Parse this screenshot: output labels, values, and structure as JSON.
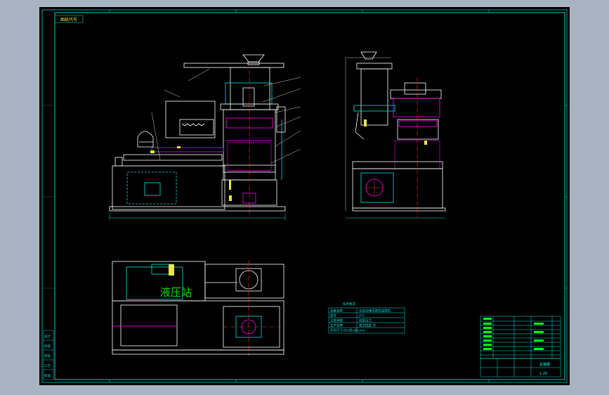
{
  "drawing": {
    "code_label": "图纸代号",
    "hydraulic_station_label": "液压站",
    "colors": {
      "sheet": "#000000",
      "frame": "#00c8c8",
      "geometry": "#ffffff",
      "hidden": "#ff00ff",
      "centerline": "#ff3030",
      "dims": "#00e0e0",
      "text_yellow": "#e8e840",
      "text_green": "#00e000"
    },
    "tech_table": {
      "title": "技术要求",
      "rows": [
        {
          "label": "设备名称",
          "value": "全自动液压砖机成型机"
        },
        {
          "label": "型号",
          "value": "JY-5"
        },
        {
          "label": "主要参数",
          "value": "成型压力"
        },
        {
          "label": "生产效率",
          "value": "每次成型 块"
        },
        {
          "label": "外形尺寸(长x宽x高)",
          "value": "mm"
        }
      ]
    },
    "title_block": {
      "drawing_name": "总装图",
      "scale": "1:20"
    },
    "left_margin_labels": [
      "设计",
      "校核",
      "审核",
      "工艺",
      "批准"
    ]
  }
}
